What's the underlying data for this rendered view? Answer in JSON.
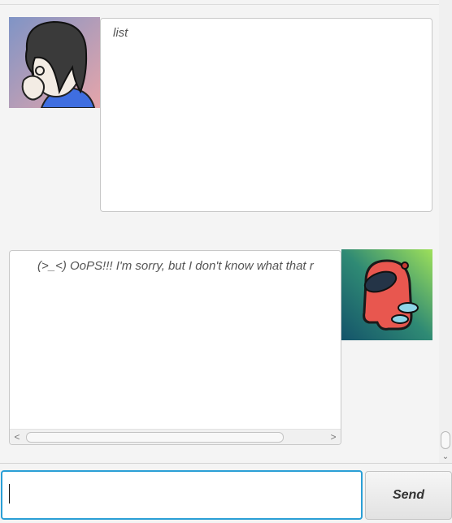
{
  "dialog": {
    "messages": [
      {
        "sender": "user",
        "avatar": "user-avatar",
        "text": "list"
      },
      {
        "sender": "bot",
        "avatar": "bot-avatar",
        "text": "(>_<) OoPS!!! I'm sorry, but I don't know what that r"
      }
    ]
  },
  "input": {
    "value": "",
    "placeholder": ""
  },
  "send_button": {
    "label": "Send"
  },
  "scrollbar": {
    "left_arrow": "<",
    "right_arrow": ">",
    "down_arrow": "⌄"
  },
  "colors": {
    "input_focus": "#2a9fd6",
    "background": "#f4f4f4"
  }
}
